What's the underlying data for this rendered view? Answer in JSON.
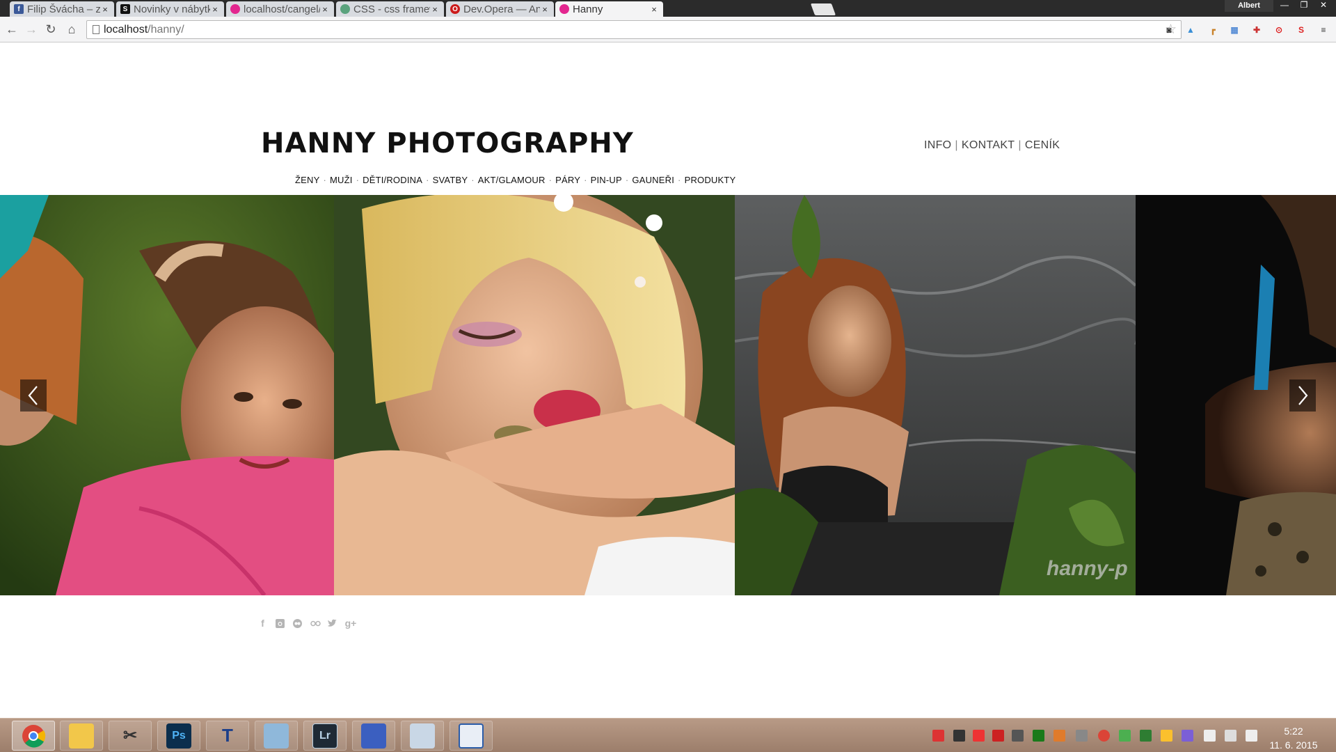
{
  "browser": {
    "tabs": [
      {
        "title": "Filip Švácha – zprávy",
        "icon": "facebook-icon",
        "color": "#3b5998",
        "glyph": "f"
      },
      {
        "title": "Novinky v nábytku a",
        "icon": "s-logo-icon",
        "color": "#111111",
        "glyph": "S"
      },
      {
        "title": "localhost/cangel/",
        "icon": "localhost-icon",
        "color": "#e3268f",
        "glyph": "◉"
      },
      {
        "title": "CSS - css framework",
        "icon": "site-icon",
        "color": "#5aa37d",
        "glyph": "◆"
      },
      {
        "title": "Dev.Opera — An Intr",
        "icon": "opera-icon",
        "color": "#cc1b1b",
        "glyph": "O"
      },
      {
        "title": "Hanny",
        "icon": "hanny-icon",
        "color": "#e3268f",
        "glyph": "◉"
      }
    ],
    "profile_name": "Albert",
    "url_host": "localhost",
    "url_path": "/hanny/"
  },
  "page": {
    "brand": "HANNY PHOTOGRAPHY",
    "top_nav": [
      "INFO",
      "KONTAKT",
      "CENÍK"
    ],
    "categories": [
      "ŽENY",
      "MUŽI",
      "DĚTI/RODINA",
      "SVATBY",
      "AKT/GLAMOUR",
      "PÁRY",
      "PIN-UP",
      "GAUNEŘI",
      "PRODUKTY"
    ],
    "watermark": "hanny-p",
    "social_icons": [
      "facebook-icon",
      "instagram-icon",
      "500px-icon",
      "flickr-icon",
      "twitter-icon",
      "google-plus-icon"
    ]
  },
  "taskbar": {
    "apps": [
      "chrome",
      "explorer",
      "tools",
      "photoshop",
      "typer",
      "cube",
      "lightroom",
      "save",
      "calculator",
      "document"
    ],
    "time": "5:22",
    "date": "11. 6. 2015"
  }
}
